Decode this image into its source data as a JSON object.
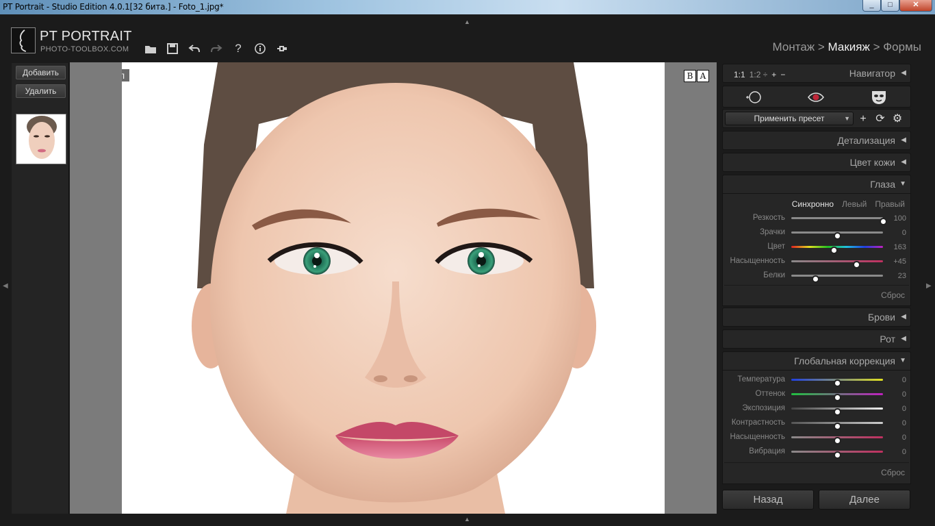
{
  "window": {
    "title": "PT Portrait - Studio Edition 4.0.1[32 бита.] - Foto_1.jpg*"
  },
  "app": {
    "brand": "PT PORTRAIT",
    "brand_sub": "PHOTO-TOOLBOX.COM"
  },
  "toolbar": [
    "folder-open-icon",
    "save-icon",
    "undo-icon",
    "redo-icon",
    "help-icon",
    "info-icon",
    "plugin-icon"
  ],
  "workflow": {
    "step1": "Монтаж",
    "sep": " > ",
    "step2": "Макияж",
    "step3": "Формы"
  },
  "left": {
    "add": "Добавить",
    "delete": "Удалить"
  },
  "viewer": {
    "original_label": "Оригинал",
    "b": "B",
    "a": "A"
  },
  "navigator": {
    "z1": "1:1",
    "z2": "1:2 ÷",
    "plus": "+",
    "minus": "−",
    "label": "Навигатор"
  },
  "preset": {
    "label": "Применить пресет"
  },
  "sections": {
    "detail": "Детализация",
    "skin": "Цвет кожи",
    "eyes": "Глаза",
    "brows": "Брови",
    "mouth": "Рот",
    "global": "Глобальная коррекция"
  },
  "eyes": {
    "tabs": {
      "sync": "Синхронно",
      "left": "Левый",
      "right": "Правый"
    },
    "sliders": [
      {
        "label": "Резкость",
        "value": "100",
        "pos": 1.0
      },
      {
        "label": "Зрачки",
        "value": "0",
        "pos": 0.5
      },
      {
        "label": "Цвет",
        "value": "163",
        "pos": 0.46
      },
      {
        "label": "Насыщенность",
        "value": "+45",
        "pos": 0.71
      },
      {
        "label": "Белки",
        "value": "23",
        "pos": 0.26
      }
    ],
    "reset": "Сброс"
  },
  "global": {
    "sliders": [
      {
        "label": "Температура",
        "value": "0",
        "pos": 0.5
      },
      {
        "label": "Оттенок",
        "value": "0",
        "pos": 0.5
      },
      {
        "label": "Экспозиция",
        "value": "0",
        "pos": 0.5
      },
      {
        "label": "Контрастность",
        "value": "0",
        "pos": 0.5
      },
      {
        "label": "Насыщенность",
        "value": "0",
        "pos": 0.5
      },
      {
        "label": "Вибрация",
        "value": "0",
        "pos": 0.5
      }
    ],
    "reset": "Сброс"
  },
  "footer": {
    "back": "Назад",
    "next": "Далее"
  }
}
